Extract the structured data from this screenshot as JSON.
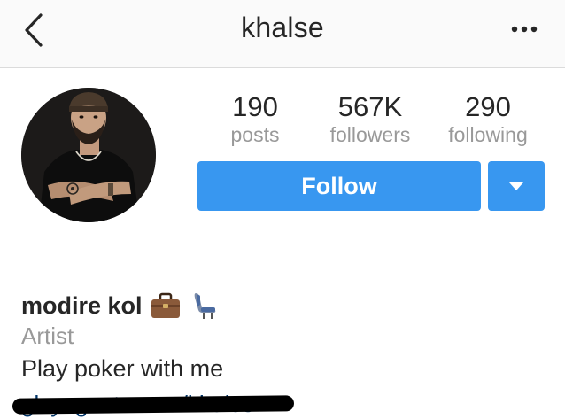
{
  "header": {
    "title": "khalse",
    "back_icon": "chevron-left-icon",
    "more_icon": "more-horizontal-icon"
  },
  "profile": {
    "avatar_icon": "profile-avatar"
  },
  "stats": {
    "posts_value": "190",
    "posts_label": "posts",
    "followers_value": "567K",
    "followers_label": "followers",
    "following_value": "290",
    "following_label": "following"
  },
  "actions": {
    "follow_label": "Follow",
    "dropdown_icon": "caret-down-icon",
    "accent_color": "#3897f0"
  },
  "bio": {
    "name": "modire kol",
    "emoji_icons": [
      "briefcase-icon",
      "seat-icon"
    ],
    "category": "Artist",
    "text": "Play poker with me",
    "link": "glxyagents.com/khalse"
  }
}
